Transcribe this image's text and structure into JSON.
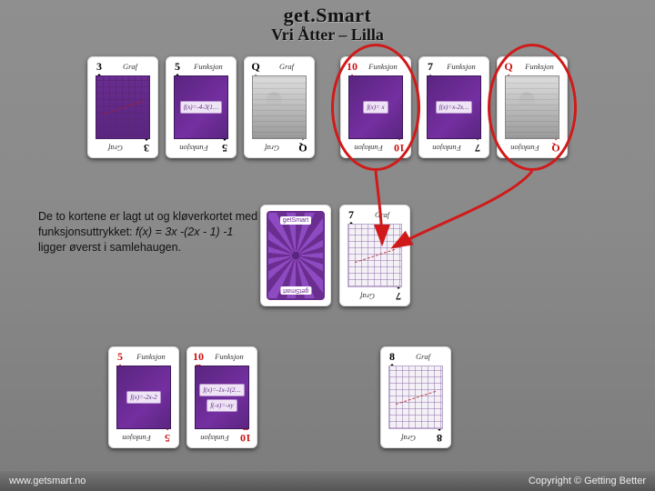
{
  "header": {
    "title": "get.Smart",
    "subtitle": "Vri Åtter – Lilla"
  },
  "description": {
    "line1": "De to kortene er lagt ut og kløverkortet med",
    "line2_prefix": "funksjonsuttrykket: ",
    "formula": "f(x) = 3x -(2x - 1) -1",
    "line3": "ligger øverst i samlehaugen."
  },
  "labels": {
    "graf": "Graf",
    "funksjon": "Funksjon"
  },
  "cards": {
    "row1": [
      {
        "rank": "3",
        "suit": "club",
        "type": "graf",
        "circle": false
      },
      {
        "rank": "5",
        "suit": "club",
        "type": "funksjon",
        "formula1": "f(x)=-4-3(1…",
        "circle": false
      },
      {
        "rank": "Q",
        "suit": "spade",
        "type": "face",
        "label": "Graf",
        "circle": false
      },
      {
        "rank": "10",
        "suit": "diamond",
        "type": "funksjon",
        "formula1": "f(x)= x",
        "circle": true
      },
      {
        "rank": "7",
        "suit": "spade",
        "type": "funksjon",
        "formula1": "f(x)=x-2x…",
        "circle": false
      },
      {
        "rank": "Q",
        "suit": "diamond",
        "type": "face",
        "label": "Funksjon",
        "circle": true
      }
    ],
    "row2": [
      {
        "type": "back",
        "brand_top": "getSmart",
        "brand_bot": "getSmart"
      },
      {
        "rank": "7",
        "suit": "club",
        "type": "graf-light"
      }
    ],
    "row3": [
      {
        "rank": "5",
        "suit": "diamond",
        "type": "funksjon",
        "formula1": "f(x)=-2x-2",
        "formula2": ""
      },
      {
        "rank": "10",
        "suit": "heart",
        "type": "funksjon",
        "formula1": "f(x)=-1x-1(2…",
        "formula2": "f(-x)=-xy"
      },
      {
        "rank": "8",
        "suit": "club",
        "type": "graf-light"
      }
    ]
  },
  "footer": {
    "left": "www.getsmart.no",
    "right": "Copyright © Getting Better"
  },
  "suit_glyphs": {
    "club": "♣",
    "spade": "♠",
    "heart": "♥",
    "diamond": "♦"
  },
  "annotation": {
    "arrow_target_note": "arrow from circled cards to 7♣ pile"
  }
}
